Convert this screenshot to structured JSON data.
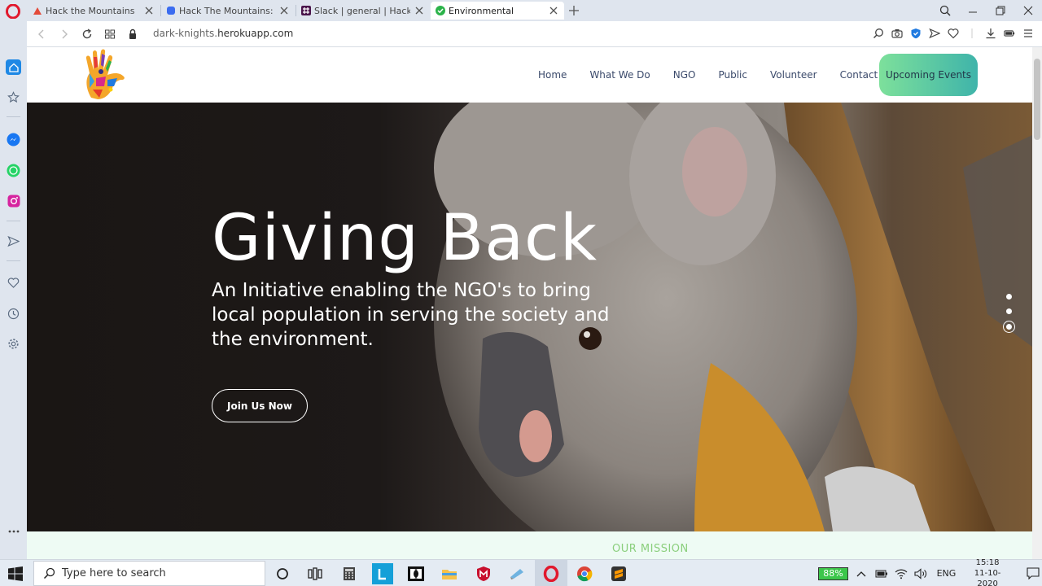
{
  "browser": {
    "tabs": [
      {
        "title": "Hack the Mountains",
        "active": false
      },
      {
        "title": "Hack The Mountains: Dash",
        "active": false
      },
      {
        "title": "Slack | general | Hack the M",
        "active": false
      },
      {
        "title": "Environmental",
        "active": true
      }
    ],
    "url_host_dim": "dark-knights.",
    "url_host": "herokuapp.com"
  },
  "nav": {
    "items": [
      "Home",
      "What We Do",
      "NGO",
      "Public",
      "Volunteer",
      "Contact"
    ],
    "cta": "Upcoming Events"
  },
  "hero": {
    "title": "Giving Back",
    "subtitle": "An Initiative enabling the NGO's to bring local population in serving the society and the environment.",
    "button": "Join Us Now",
    "slides_total": 3,
    "slide_active": 3
  },
  "mission": {
    "title": "OUR MISSION"
  },
  "taskbar": {
    "search_placeholder": "Type here to search",
    "battery": "88%",
    "language": "ENG",
    "time": "15:18",
    "date": "11-10-2020"
  },
  "colors": {
    "accent_green": "#7de09b",
    "accent_teal": "#3fb4aa",
    "nav_text": "#3b4a6b",
    "mission_green": "#8bcf7d"
  }
}
